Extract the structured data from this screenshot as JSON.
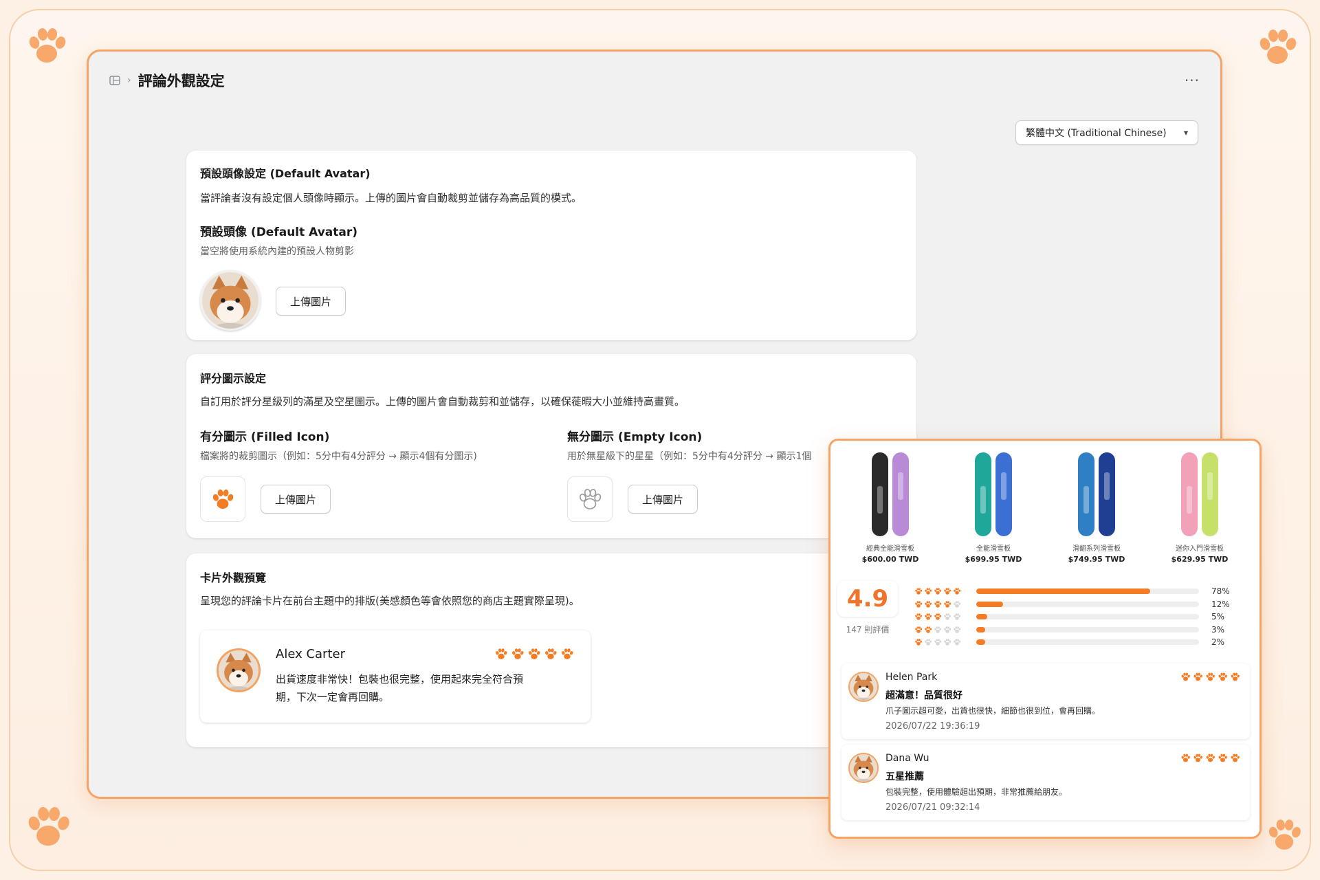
{
  "header": {
    "title": "評論外觀設定",
    "more_label": "···"
  },
  "language": {
    "selected": "繁體中文 (Traditional Chinese)"
  },
  "avatar_card": {
    "title": "預設頭像設定 (Default Avatar)",
    "description": "當評論者沒有設定個人頭像時顯示。上傳的圖片會自動裁剪並儲存為高品質的模式。",
    "sub_title": "預設頭像 (Default Avatar)",
    "sub_description": "當空將使用系統內建的預設人物剪影",
    "upload_label": "上傳圖片"
  },
  "rating_card": {
    "title": "評分圖示設定",
    "description": "自訂用於評分星級列的滿星及空星圖示。上傳的圖片會自動裁剪和並儲存，以確保蓰暇大小並維持高畫質。",
    "filled": {
      "title": "有分圖示 (Filled Icon)",
      "description": "檔案將的裁剪圖示（例如：5分中有4分評分 → 顯示4個有分圖示)",
      "upload_label": "上傳圖片"
    },
    "empty": {
      "title": "無分圖示 (Empty Icon)",
      "description": "用於無星級下的星星（例如：5分中有4分評分 → 顯示1個",
      "upload_label": "上傳圖片"
    }
  },
  "preview_card": {
    "title": "卡片外觀預覽",
    "description": "呈現您的評論卡片在前台主題中的排版(美感顏色等會依照您的商店主題實際呈現)。",
    "review": {
      "name": "Alex Carter",
      "rating": 5,
      "body_line1": "出貨速度非常快！包裝也很完整，使用起來完全符合預",
      "body_line2": "期，下次一定會再回購。"
    }
  },
  "colors": {
    "accent": "#f57c22",
    "frame_border": "#f6a365",
    "empty_paw": "#d6d6d6"
  },
  "widget": {
    "products": [
      {
        "name": "經典全能滑雪板",
        "price": "$600.00 TWD",
        "left_color": "#2a2a2a",
        "right_color": "#b98ad6"
      },
      {
        "name": "全能滑雪板",
        "price": "$699.95 TWD",
        "left_color": "#1fa89a",
        "right_color": "#3b6fd4"
      },
      {
        "name": "滑翻系列滑雪板",
        "price": "$749.95 TWD",
        "left_color": "#2f7fc4",
        "right_color": "#1f3f93"
      },
      {
        "name": "迷你入門滑雪板",
        "price": "$629.95 TWD",
        "left_color": "#f2a2b8",
        "right_color": "#c6e06a"
      }
    ],
    "rating": "4.9",
    "rating_count": "147 則評價",
    "distribution": [
      {
        "stars": 5,
        "percent": 78,
        "label": "78%"
      },
      {
        "stars": 4,
        "percent": 12,
        "label": "12%"
      },
      {
        "stars": 3,
        "percent": 5,
        "label": "5%"
      },
      {
        "stars": 2,
        "percent": 3,
        "label": "3%"
      },
      {
        "stars": 1,
        "percent": 2,
        "label": "2%"
      }
    ],
    "reviews": [
      {
        "name": "Helen Park",
        "title": "超滿意！品質很好",
        "body": "爪子圖示超可愛，出貨也很快，細節也很到位，會再回購。",
        "date": "2026/07/22 19:36:19",
        "rating": 5
      },
      {
        "name": "Dana Wu",
        "title": "五星推薦",
        "body": "包裝完整，使用體驗超出預期，非常推薦給朋友。",
        "date": "2026/07/21 09:32:14",
        "rating": 5
      }
    ]
  }
}
